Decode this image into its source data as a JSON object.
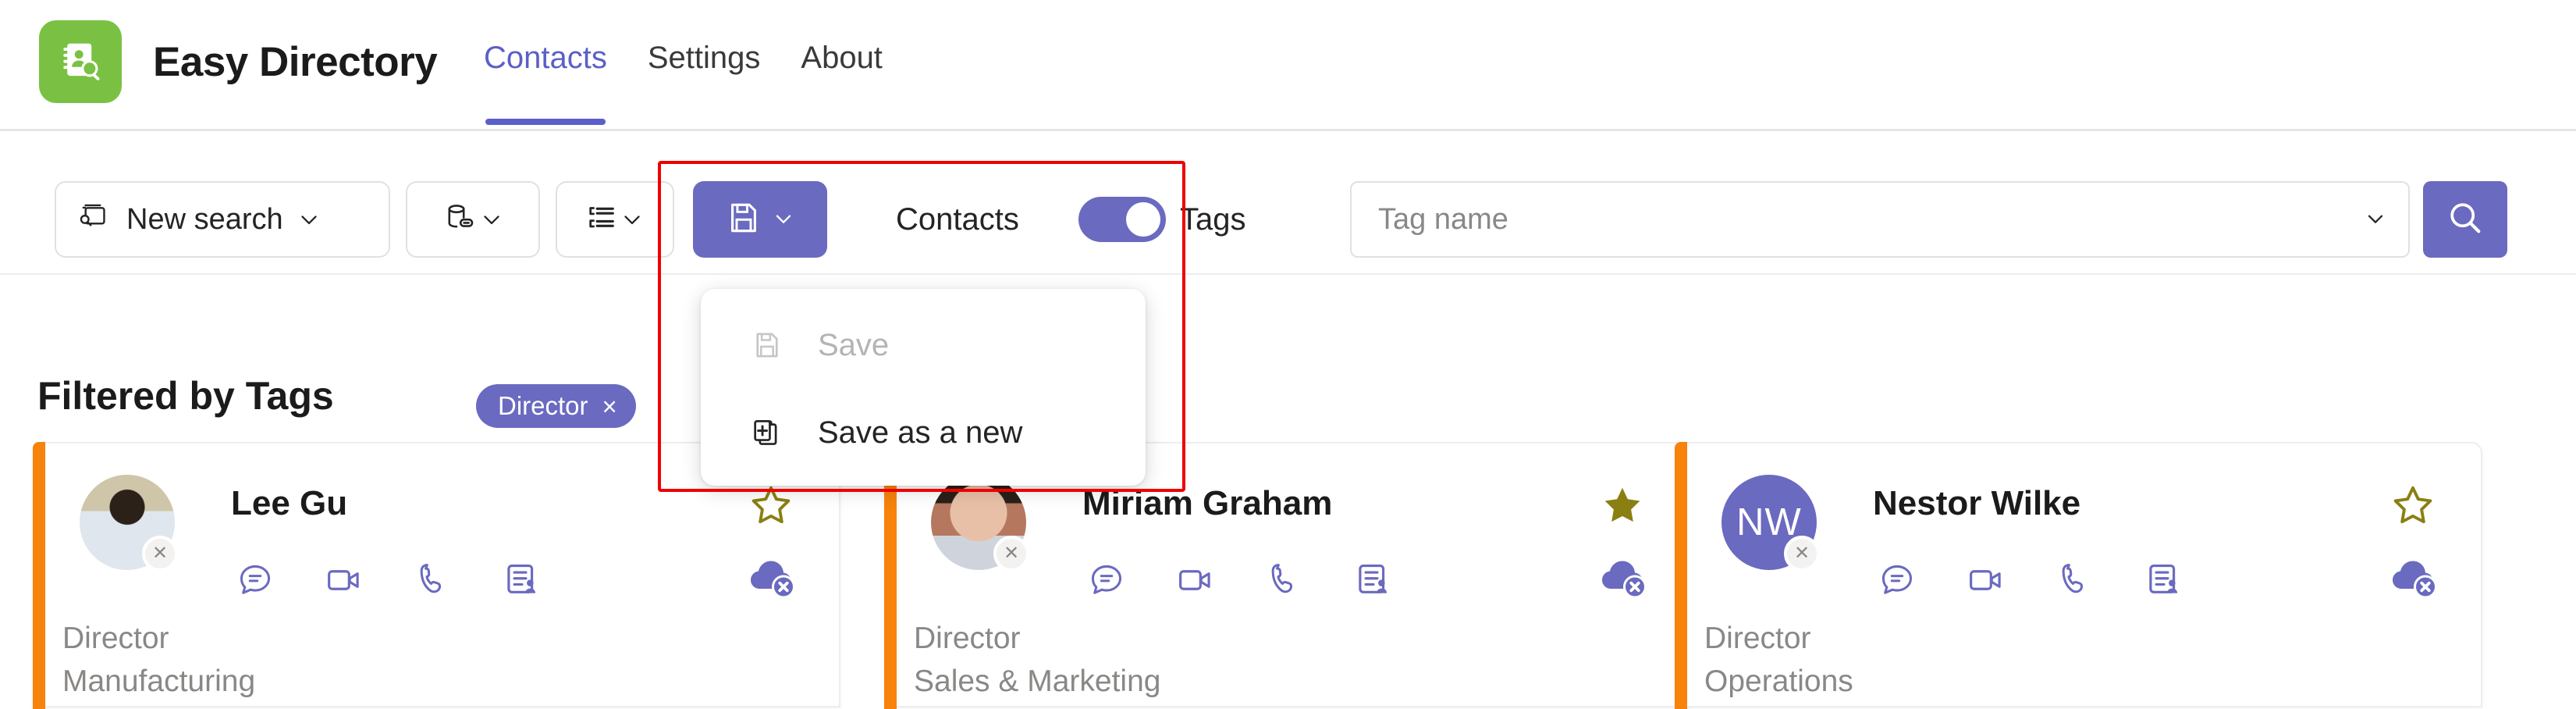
{
  "header": {
    "logo_icon": "contact-book-search-icon",
    "brand_title": "Easy Directory",
    "nav": [
      {
        "label": "Contacts",
        "active": true
      },
      {
        "label": "Settings",
        "active": false
      },
      {
        "label": "About",
        "active": false
      }
    ]
  },
  "toolbar": {
    "new_search": {
      "label": "New search",
      "icon": "new-search-icon",
      "chevron": "chevron-down-icon"
    },
    "source_button": {
      "icon": "data-source-icon",
      "chevron": "chevron-down-icon"
    },
    "sort_button": {
      "icon": "list-view-icon",
      "chevron": "chevron-down-icon"
    },
    "save_button": {
      "icon": "save-floppy-icon",
      "chevron": "chevron-down-icon"
    },
    "mode_switch": {
      "left_label": "Contacts",
      "right_label": "Tags",
      "state": "on"
    },
    "tag_field": {
      "placeholder": "Tag name",
      "value": "",
      "chevron": "chevron-down-icon"
    },
    "search_button": {
      "icon": "search-icon"
    }
  },
  "save_menu": {
    "items": [
      {
        "label": "Save",
        "icon": "save-floppy-icon",
        "disabled": true
      },
      {
        "label": "Save as a new",
        "icon": "save-as-new-icon",
        "disabled": false
      }
    ]
  },
  "filter": {
    "title": "Filtered by Tags",
    "chips": [
      {
        "label": "Director",
        "remove": "×"
      }
    ]
  },
  "colors": {
    "brand_green": "#7AC143",
    "accent_purple": "#6a6ac0",
    "nav_active": "#5b5fc7",
    "card_accent_orange": "#F7820C",
    "star_gold": "#8a7f11",
    "annotation_red": "#ef0000"
  },
  "contacts": [
    {
      "name": "Lee Gu",
      "role": "Director",
      "department": "Manufacturing",
      "avatar_type": "photo",
      "initials": "",
      "starred": false,
      "presence": "offline",
      "actions": [
        "chat-icon",
        "video-call-icon",
        "phone-call-icon",
        "contact-card-icon"
      ],
      "cloud_icon": "cloud-offline-icon",
      "star_icon": "star-outline-icon"
    },
    {
      "name": "Miriam Graham",
      "role": "Director",
      "department": "Sales & Marketing",
      "avatar_type": "photo",
      "initials": "",
      "starred": true,
      "presence": "offline",
      "actions": [
        "chat-icon",
        "video-call-icon",
        "phone-call-icon",
        "contact-card-icon"
      ],
      "cloud_icon": "cloud-offline-icon",
      "star_icon": "star-filled-icon"
    },
    {
      "name": "Nestor Wilke",
      "role": "Director",
      "department": "Operations",
      "avatar_type": "initials",
      "initials": "NW",
      "starred": false,
      "presence": "offline",
      "actions": [
        "chat-icon",
        "video-call-icon",
        "phone-call-icon",
        "contact-card-icon"
      ],
      "cloud_icon": "cloud-offline-icon",
      "star_icon": "star-outline-icon"
    }
  ]
}
